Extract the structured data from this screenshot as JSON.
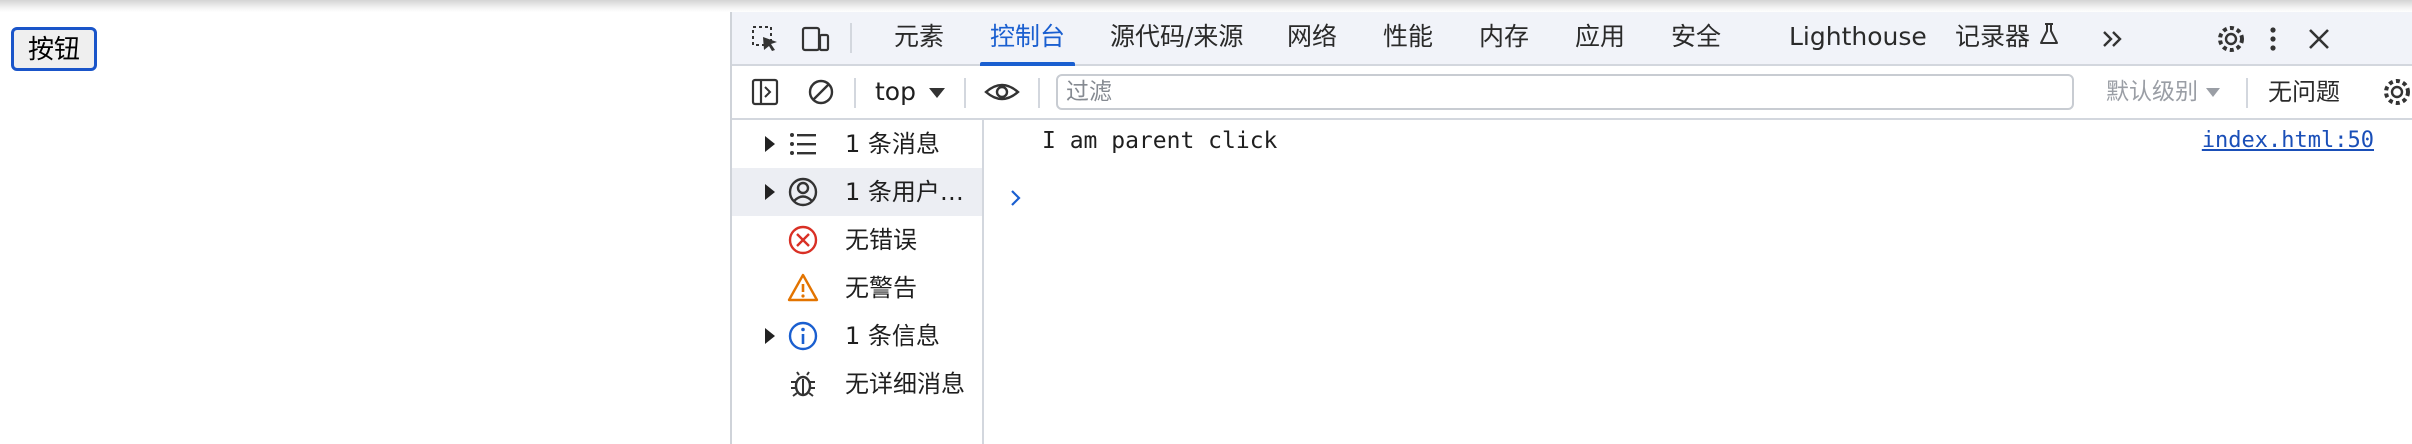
{
  "page": {
    "button_label": "按钮"
  },
  "devtools": {
    "tabs": [
      {
        "label": "元素",
        "active": false
      },
      {
        "label": "控制台",
        "active": true
      },
      {
        "label": "源代码/来源",
        "active": false
      },
      {
        "label": "网络",
        "active": false
      },
      {
        "label": "性能",
        "active": false
      },
      {
        "label": "内存",
        "active": false
      },
      {
        "label": "应用",
        "active": false
      },
      {
        "label": "安全",
        "active": false
      },
      {
        "label": "Lighthouse",
        "active": false
      },
      {
        "label": "记录器",
        "active": false
      }
    ],
    "toolbar": {
      "context": "top",
      "filter_placeholder": "过滤",
      "levels_label": "默认级别",
      "issues_label": "无问题"
    },
    "sidebar": {
      "items": [
        {
          "label": "1 条消息",
          "icon": "list-icon",
          "expandable": true,
          "selected": false
        },
        {
          "label": "1 条用户…",
          "icon": "user-icon",
          "expandable": true,
          "selected": true
        },
        {
          "label": "无错误",
          "icon": "error-icon",
          "expandable": false,
          "selected": false
        },
        {
          "label": "无警告",
          "icon": "warning-icon",
          "expandable": false,
          "selected": false
        },
        {
          "label": "1 条信息",
          "icon": "info-icon",
          "expandable": true,
          "selected": false
        },
        {
          "label": "无详细消息",
          "icon": "bug-icon",
          "expandable": false,
          "selected": false
        }
      ]
    },
    "console": {
      "message": "I am parent click",
      "source": "index.html:50"
    },
    "colors": {
      "accent": "#1a5fd0",
      "error": "#d93025",
      "warning": "#e37400",
      "info": "#1a5fd0"
    }
  }
}
